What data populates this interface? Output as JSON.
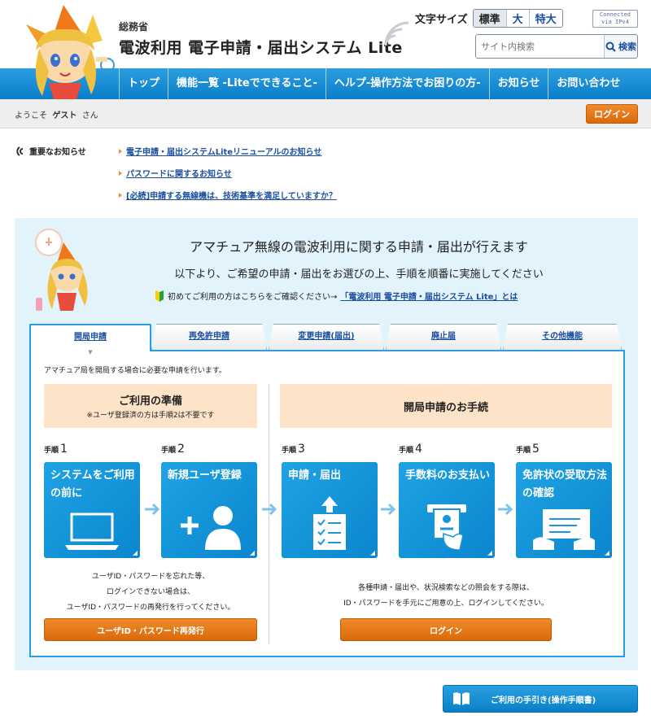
{
  "header": {
    "ministry": "総務省",
    "title": "電波利用 電子申請・届出システム Lite",
    "font_size_label": "文字サイズ",
    "font_sizes": [
      "標準",
      "大",
      "特大"
    ],
    "ipv4_badge_line1": "Connected",
    "ipv4_badge_line2": "via IPv4",
    "search_placeholder": "サイト内検索",
    "search_button": "検索"
  },
  "nav": {
    "items": [
      "トップ",
      "機能一覧 -Liteでできること-",
      "ヘルプ-操作方法でお困りの方-",
      "お知らせ",
      "お問い合わせ"
    ]
  },
  "welcome": {
    "prefix": "ようこそ",
    "user": "ゲスト",
    "suffix": "さん",
    "login": "ログイン"
  },
  "notices": {
    "heading": "重要なお知らせ",
    "items": [
      "電子申請・届出システムLiteリニューアルのお知らせ",
      "パスワードに関するお知らせ",
      "[必読]申請する無線機は、技術基準を満足していますか？"
    ]
  },
  "panel": {
    "title": "アマチュア無線の電波利用に関する申請・届出が行えます",
    "subtitle": "以下より、ご希望の申請・届出をお選びの上、手順を順番に実施してください",
    "first_time_text": "初めてご利用の方はこちらをご確認ください→",
    "first_time_link": "「電波利用 電子申請・届出システム Lite」とは",
    "tabs": [
      "開局申請",
      "再免許申請",
      "変更申請(届出)",
      "廃止届",
      "その他機能"
    ],
    "tab_description": "アマチュア局を開局する場合に必要な申請を行います。",
    "prep_title": "ご利用の準備",
    "prep_note": "※ユーザ登録済の方は手順2は不要です",
    "proc_title": "開局申請のお手続",
    "step_prefix": "手順",
    "steps": [
      {
        "num": "1",
        "title": "システムをご利用の前に"
      },
      {
        "num": "2",
        "title": "新規ユーザ登録"
      },
      {
        "num": "3",
        "title": "申請・届出"
      },
      {
        "num": "4",
        "title": "手数料のお支払い"
      },
      {
        "num": "5",
        "title": "免許状の受取方法の確認"
      }
    ],
    "help_left": [
      "ユーザID・パスワードを忘れた等、",
      "ログインできない場合は、",
      "ユーザID・パスワードの再発行を行ってください。"
    ],
    "help_right": [
      "各種申請・届出や、状況検索などの照会をする際は、",
      "ID・パスワードを手元にご用意の上、ログインしてください。"
    ],
    "reissue_button": "ユーザID・パスワード再発行",
    "login_button": "ログイン"
  },
  "manual_button": "ご利用の手引き(操作手順書)",
  "colors": {
    "nav_blue": "#0c7dc8",
    "card_blue": "#1fa3e3",
    "orange": "#e0761a",
    "panel_bg": "#e2f3fb",
    "peach": "#fde3c8"
  }
}
